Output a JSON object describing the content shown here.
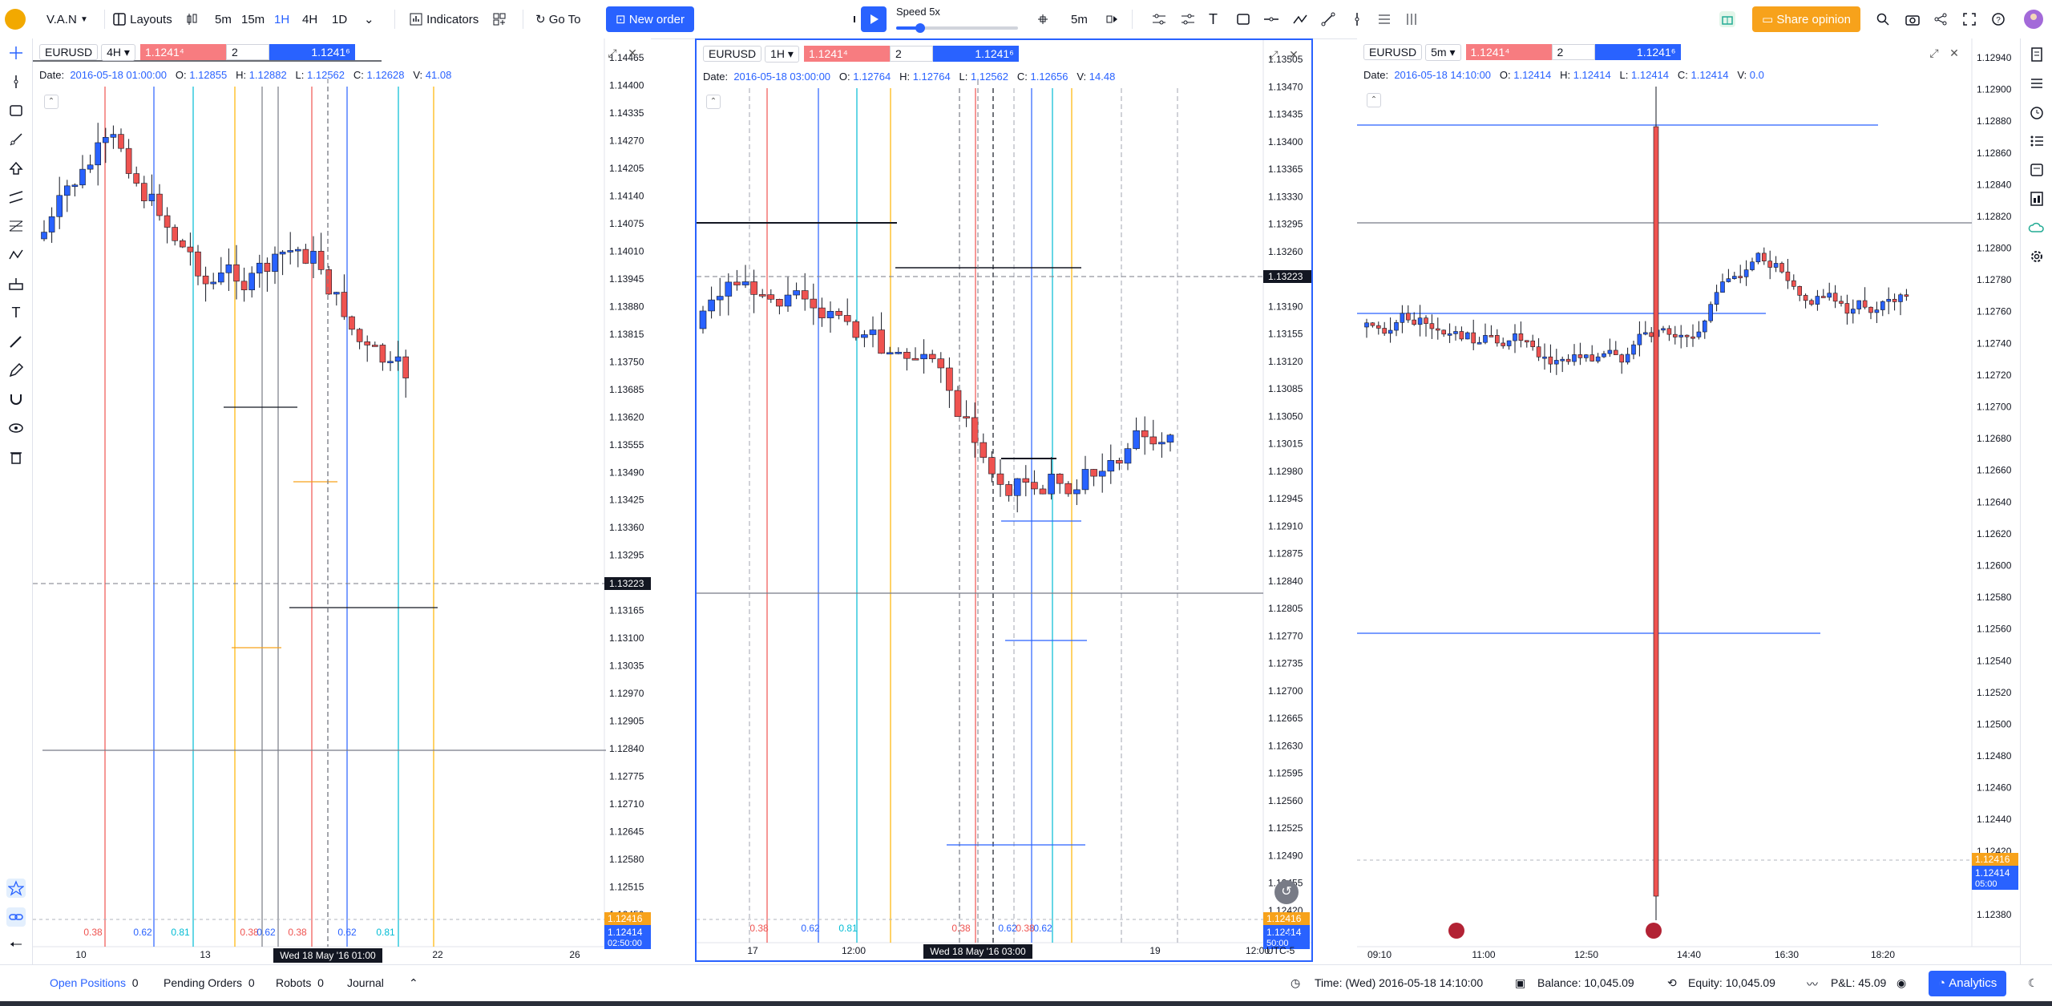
{
  "toolbar": {
    "account": "V.A.N",
    "layouts": "Layouts",
    "tf_5m": "5m",
    "tf_15m": "15m",
    "tf_1h": "1H",
    "tf_4h": "4H",
    "tf_1d": "1D",
    "indicators": "Indicators",
    "goto": "Go To",
    "new_order": "New order",
    "speed": "Speed 5x",
    "step": "5m",
    "share": "Share opinion",
    "accent": "#2962ff"
  },
  "panes": [
    {
      "symbol": "EURUSD",
      "timeframe": "4H",
      "sell": "1.1241⁴",
      "qty": "2",
      "buy": "1.1241⁶",
      "date_label": "Date:",
      "date": "2016-05-18 01:00:00",
      "o": "1.12855",
      "h": "1.12882",
      "l": "1.12562",
      "c": "1.12628",
      "v": "41.08",
      "price_ticks": [
        "1.14465",
        "1.14400",
        "1.14335",
        "1.14270",
        "1.14205",
        "1.14140",
        "1.14075",
        "1.14010",
        "1.13945",
        "1.13880",
        "1.13815",
        "1.13750",
        "1.13685",
        "1.13620",
        "1.13555",
        "1.13490",
        "1.13425",
        "1.13360",
        "1.13295",
        "1.13230",
        "1.13165",
        "1.13100",
        "1.13035",
        "1.12970",
        "1.12905",
        "1.12840",
        "1.12775",
        "1.12710",
        "1.12645",
        "1.12580",
        "1.12515",
        "1.12450"
      ],
      "crosshair_price": "1.13223",
      "last_price": "1.12416",
      "bid_price": "1.12414",
      "countdown": "02:50:00",
      "time_ticks": [
        "10",
        "13",
        "22",
        "26"
      ],
      "cursor_time": "Wed 18 May '16 01:00",
      "fib_labels": [
        "0.38",
        "0.62",
        "0.81",
        "0.38",
        "0.62",
        "0.38",
        "0.62",
        "0.81"
      ]
    },
    {
      "symbol": "EURUSD",
      "timeframe": "1H",
      "sell": "1.1241⁴",
      "qty": "2",
      "buy": "1.1241⁶",
      "date_label": "Date:",
      "date": "2016-05-18 03:00:00",
      "o": "1.12764",
      "h": "1.12764",
      "l": "1.12562",
      "c": "1.12656",
      "v": "14.48",
      "price_ticks": [
        "1.13505",
        "1.13470",
        "1.13435",
        "1.13400",
        "1.13365",
        "1.13330",
        "1.13295",
        "1.13260",
        "1.13225",
        "1.13190",
        "1.13155",
        "1.13120",
        "1.13085",
        "1.13050",
        "1.13015",
        "1.12980",
        "1.12945",
        "1.12910",
        "1.12875",
        "1.12840",
        "1.12805",
        "1.12770",
        "1.12735",
        "1.12700",
        "1.12665",
        "1.12630",
        "1.12595",
        "1.12560",
        "1.12525",
        "1.12490",
        "1.12455",
        "1.12420"
      ],
      "crosshair_price": "1.13223",
      "last_price": "1.12416",
      "bid_price": "1.12414",
      "countdown": "50:00",
      "time_ticks": [
        "17",
        "12:00",
        "12:00",
        "19",
        "12:00"
      ],
      "cursor_time": "Wed 18 May '16 03:00",
      "fib_labels": [
        "0.38",
        "0.62",
        "0.81",
        "0.38",
        "0.62",
        "0.38",
        "0.62"
      ],
      "utc": "UTC-5"
    },
    {
      "symbol": "EURUSD",
      "timeframe": "5m",
      "sell": "1.1241⁴",
      "qty": "2",
      "buy": "1.1241⁶",
      "date_label": "Date:",
      "date": "2016-05-18 14:10:00",
      "o": "1.12414",
      "h": "1.12414",
      "l": "1.12414",
      "c": "1.12414",
      "v": "0.0",
      "price_ticks": [
        "1.12940",
        "1.12900",
        "1.12880",
        "1.12860",
        "1.12840",
        "1.12820",
        "1.12800",
        "1.12780",
        "1.12760",
        "1.12740",
        "1.12720",
        "1.12700",
        "1.12680",
        "1.12660",
        "1.12640",
        "1.12620",
        "1.12600",
        "1.12580",
        "1.12560",
        "1.12540",
        "1.12520",
        "1.12500",
        "1.12480",
        "1.12460",
        "1.12440",
        "1.12420",
        "1.12400",
        "1.12380"
      ],
      "last_price": "1.12416",
      "bid_price": "1.12414",
      "countdown": "05:00",
      "time_ticks": [
        "09:10",
        "11:00",
        "12:50",
        "14:40",
        "16:30",
        "18:20"
      ]
    }
  ],
  "bottom": {
    "tabs": [
      {
        "label": "Open Positions",
        "count": "0"
      },
      {
        "label": "Pending Orders",
        "count": "0"
      },
      {
        "label": "Robots",
        "count": "0"
      },
      {
        "label": "Journal",
        "count": ""
      }
    ],
    "time": "Time: (Wed) 2016-05-18 14:10:00",
    "balance": "Balance: 10,045.09",
    "equity": "Equity: 10,045.09",
    "pnl": "P&L: 45.09",
    "analytics": "Analytics"
  }
}
